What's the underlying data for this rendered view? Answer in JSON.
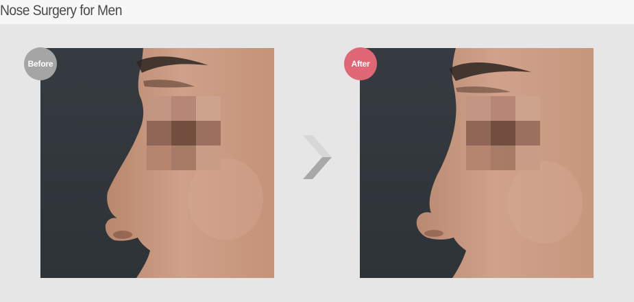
{
  "header": {
    "title": "Nose Surgery for Men"
  },
  "photos": {
    "before": {
      "badge_label": "Before",
      "badge_color": "#a5a5a5"
    },
    "after": {
      "badge_label": "After",
      "badge_color": "#e06775"
    }
  },
  "divider": {
    "icon": "chevron-right-icon"
  },
  "colors": {
    "page_background": "#e6e6e6",
    "header_background": "#f7f7f7",
    "photo_background": "#3a4046",
    "skin": "#c99a80"
  }
}
